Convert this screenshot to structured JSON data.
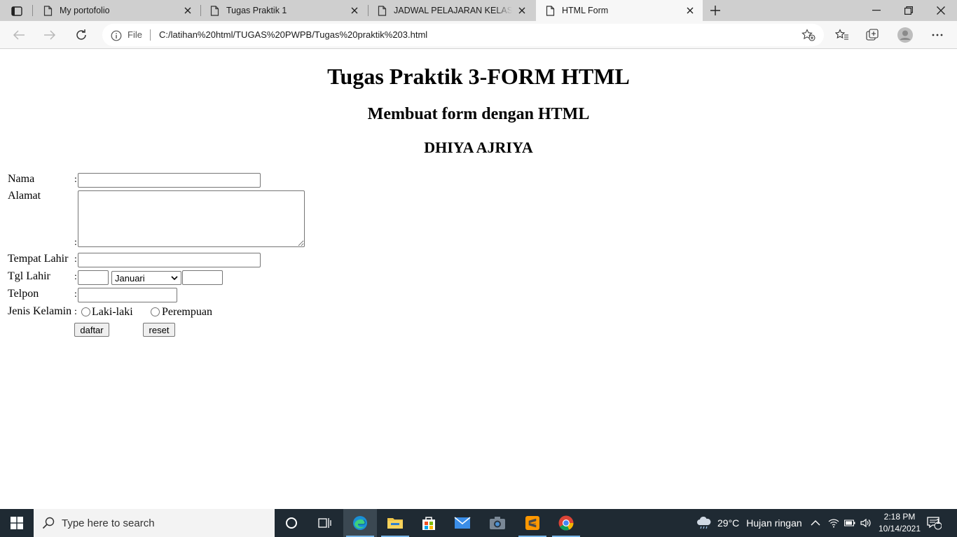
{
  "browser": {
    "tabs": [
      {
        "title": "My portofolio",
        "active": false
      },
      {
        "title": "Tugas Praktik 1",
        "active": false
      },
      {
        "title": "JADWAL PELAJARAN KELAS XI RPL",
        "active": false
      },
      {
        "title": "HTML Form",
        "active": true
      }
    ],
    "address": {
      "scheme_label": "File",
      "url": "C:/latihan%20html/TUGAS%20PWPB/Tugas%20praktik%203.html"
    }
  },
  "page": {
    "title": "Tugas Praktik 3-FORM HTML",
    "subtitle": "Membuat form dengan HTML",
    "author": "DHIYA AJRIYA",
    "form": {
      "separator": ":",
      "nama_label": "Nama",
      "alamat_label": "Alamat",
      "tempat_lahir_label": "Tempat Lahir",
      "tgl_lahir_label": "Tgl Lahir",
      "bulan_selected": "Januari",
      "telpon_label": "Telpon",
      "jenis_kelamin_label": "Jenis Kelamin",
      "options_gender": [
        "Laki-laki",
        "Perempuan"
      ],
      "submit_label": "daftar",
      "reset_label": "reset"
    }
  },
  "taskbar": {
    "search_placeholder": "Type here to search",
    "weather_temp": "29°C",
    "weather_desc": "Hujan ringan",
    "time": "2:18 PM",
    "date": "10/14/2021",
    "notification_count": "1"
  },
  "colors": {
    "tabstrip": "#cfcfcf",
    "toolbar": "#f7f7f7",
    "taskbar": "#1f2a33",
    "accent": "#78b6e8"
  }
}
